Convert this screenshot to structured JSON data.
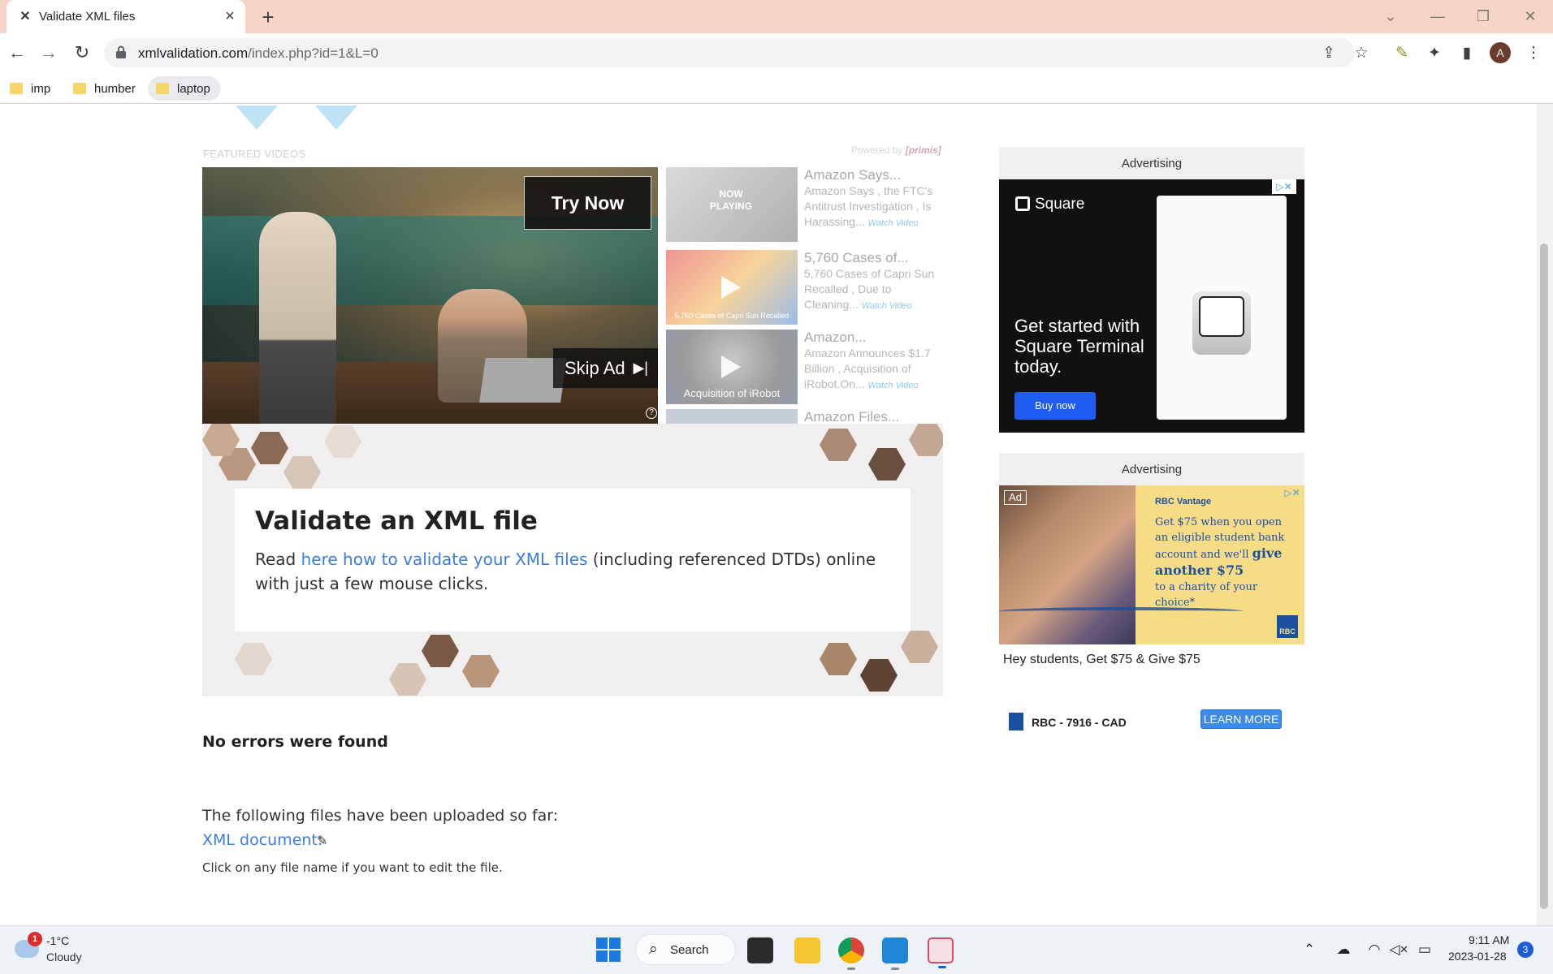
{
  "browser": {
    "tab_title": "Validate XML files",
    "tab_favicon": "x-logo-icon",
    "url_domain": "xmlvalidation.com",
    "url_path": "/index.php?id=1&L=0",
    "profile_initial": "A",
    "bookmarks": [
      "imp",
      "humber",
      "laptop"
    ]
  },
  "video": {
    "featured_label": "FEATURED VIDEOS",
    "powered_prefix": "Powered by",
    "powered_brand": "[primis]",
    "try_now": "Try Now",
    "skip_ad": "Skip Ad",
    "help": "?",
    "playlist": [
      {
        "title": "Amazon Says...",
        "desc": "Amazon Says , the FTC's Antitrust Investigation , Is Harassing...",
        "watch": "Watch Video",
        "overlay": "NOW PLAYING",
        "caption": ""
      },
      {
        "title": "5,760 Cases of...",
        "desc": "5,760 Cases of Capri Sun Recalled , Due to Cleaning...",
        "watch": "Watch Video",
        "overlay": "",
        "caption": "5,760 Cases of Capri Sun Recalled"
      },
      {
        "title": "Amazon...",
        "desc": "Amazon Announces $1.7 Billion , Acquisition of iRobot.On...",
        "watch": "Watch Video",
        "overlay": "",
        "caption": "Acquisition of iRobot"
      },
      {
        "title": "Amazon Files...",
        "desc": "",
        "watch": "",
        "overlay": "",
        "caption": ""
      }
    ]
  },
  "hero": {
    "title": "Validate an XML file",
    "text_before": "Read ",
    "link_text": "here how to validate your XML files",
    "text_after": " (including referenced DTDs) online with just a few mouse clicks."
  },
  "results": {
    "status": "No errors were found",
    "uploaded_intro": "The following files have been uploaded so far:",
    "file_link": "XML document:",
    "hint": "Click on any file name if you want to edit the file."
  },
  "ads": {
    "label_1": "Advertising",
    "label_2": "Advertising",
    "square": {
      "brand": "Square",
      "headline": "Get started with Square Terminal today.",
      "button": "Buy now"
    },
    "rbc": {
      "badge": "Ad",
      "brand": "RBC Vantage",
      "line1": "Get $75 when you open an eligible student bank account and we'll",
      "line2": "give another $75",
      "line3": "to a charity of your choice*",
      "logo": "RBC",
      "caption": "Hey students, Get $75 & Give $75",
      "sponsor": "RBC - 7916 - CAD",
      "learn_more": "LEARN MORE"
    }
  },
  "taskbar": {
    "weather_badge": "1",
    "temperature": "-1°C",
    "condition": "Cloudy",
    "search_label": "Search",
    "time": "9:11 AM",
    "date": "2023-01-28",
    "notifications": "3"
  }
}
